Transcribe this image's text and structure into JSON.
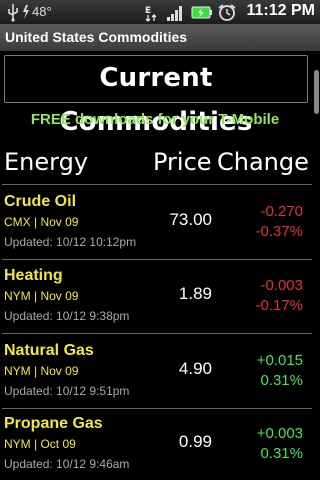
{
  "status": {
    "temperature": "48°",
    "time": "11:12 PM",
    "icons": [
      "usb-icon",
      "weather-icon",
      "data-icon",
      "signal-icon",
      "battery-icon",
      "alarm-icon"
    ],
    "battery_color": "#3ce03c"
  },
  "app_title": "United States Commodities",
  "heading": "Current Commodities",
  "banner": "FREE downloads for your T-Mobile",
  "columns": {
    "category": "Energy",
    "price": "Price",
    "change": "Change"
  },
  "rows": [
    {
      "name": "Crude Oil",
      "exchange": "CMX | Nov 09",
      "updated": "Updated: 10/12 10:12pm",
      "price": "73.00",
      "change": "-0.270",
      "change_pct": "-0.37%",
      "direction": "down"
    },
    {
      "name": "Heating",
      "exchange": "NYM | Nov 09",
      "updated": "Updated: 10/12 9:38pm",
      "price": "1.89",
      "change": "-0.003",
      "change_pct": "-0.17%",
      "direction": "down"
    },
    {
      "name": "Natural Gas",
      "exchange": "NYM | Nov 09",
      "updated": "Updated: 10/12 9:51pm",
      "price": "4.90",
      "change": "+0.015",
      "change_pct": "0.31%",
      "direction": "up"
    },
    {
      "name": "Propane Gas",
      "exchange": "NYM | Oct 09",
      "updated": "Updated: 10/12 9:46am",
      "price": "0.99",
      "change": "+0.003",
      "change_pct": "0.31%",
      "direction": "up"
    }
  ],
  "colors": {
    "name": "#f5e63c",
    "negative": "#e53030",
    "positive": "#3ee84a",
    "banner": "#8fe85a"
  }
}
